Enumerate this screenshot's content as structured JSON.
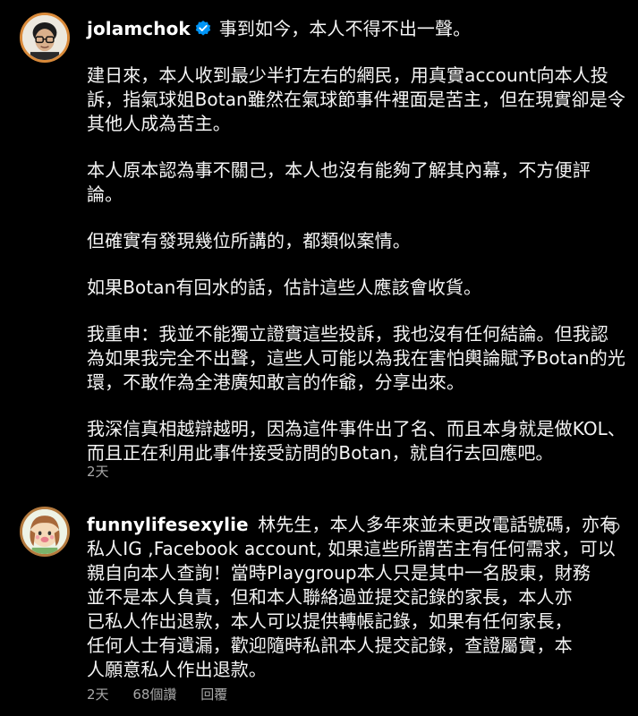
{
  "comments": [
    {
      "username": "jolamchok",
      "verified": true,
      "first_line": "事到如今，本人不得不出一聲。",
      "paragraphs": [
        [
          "建日來，本人收到最少半打左右的網民，用真實account向本人投",
          "訴，指氣球姐Botan雖然在氣球節事件裡面是苦主，但在現實卻是令",
          "其他人成為苦主。"
        ],
        [
          "本人原本認為事不關己，本人也沒有能夠了解其內幕，不方便評",
          "論。"
        ],
        [
          "但確實有發現幾位所講的，都類似案情。"
        ],
        [
          "如果Botan有回水的話，估計這些人應該會收貨。"
        ],
        [
          "我重申：我並不能獨立證實這些投訴，我也沒有任何結論。但我認",
          "為如果我完全不出聲，這些人可能以為我在害怕輿論賦予Botan的光",
          "環，不敢作為全港廣知敢言的作爺，分享出來。"
        ],
        [
          "我深信真相越辯越明，因為這件事件出了名、而且本身就是做KOL、",
          "而且正在利用此事件接受訪問的Botan，就自行去回應吧。"
        ]
      ],
      "time": "2天"
    },
    {
      "username": "funnylifesexylie",
      "verified": false,
      "first_line": "林先生，本人多年來並未更改電話號碼，亦有",
      "lines": [
        "私人IG ,Facebook account, 如果這些所謂苦主有任何需求，可以",
        "親自向本人查詢！當時Playgroup本人只是其中一名股東，財務",
        "並不是本人負責，但和本人聯絡過並提交記錄的家長，本人亦",
        "已私人作出退款，本人可以提供轉帳記錄，如果有任何家長，",
        "任何人士有遺漏，歡迎隨時私訊本人提交記錄，查證屬實，本",
        "人願意私人作出退款。"
      ],
      "time": "2天",
      "likes": "68個讚",
      "reply_label": "回覆"
    }
  ],
  "colors": {
    "background": "#000000",
    "text": "#f5f5f5",
    "meta": "#a8a8a8",
    "verified": "#0095f6",
    "avatar_ring": "#d98a3a"
  },
  "icons": {
    "verified": "verified-badge-icon",
    "like": "heart-outline-icon"
  }
}
